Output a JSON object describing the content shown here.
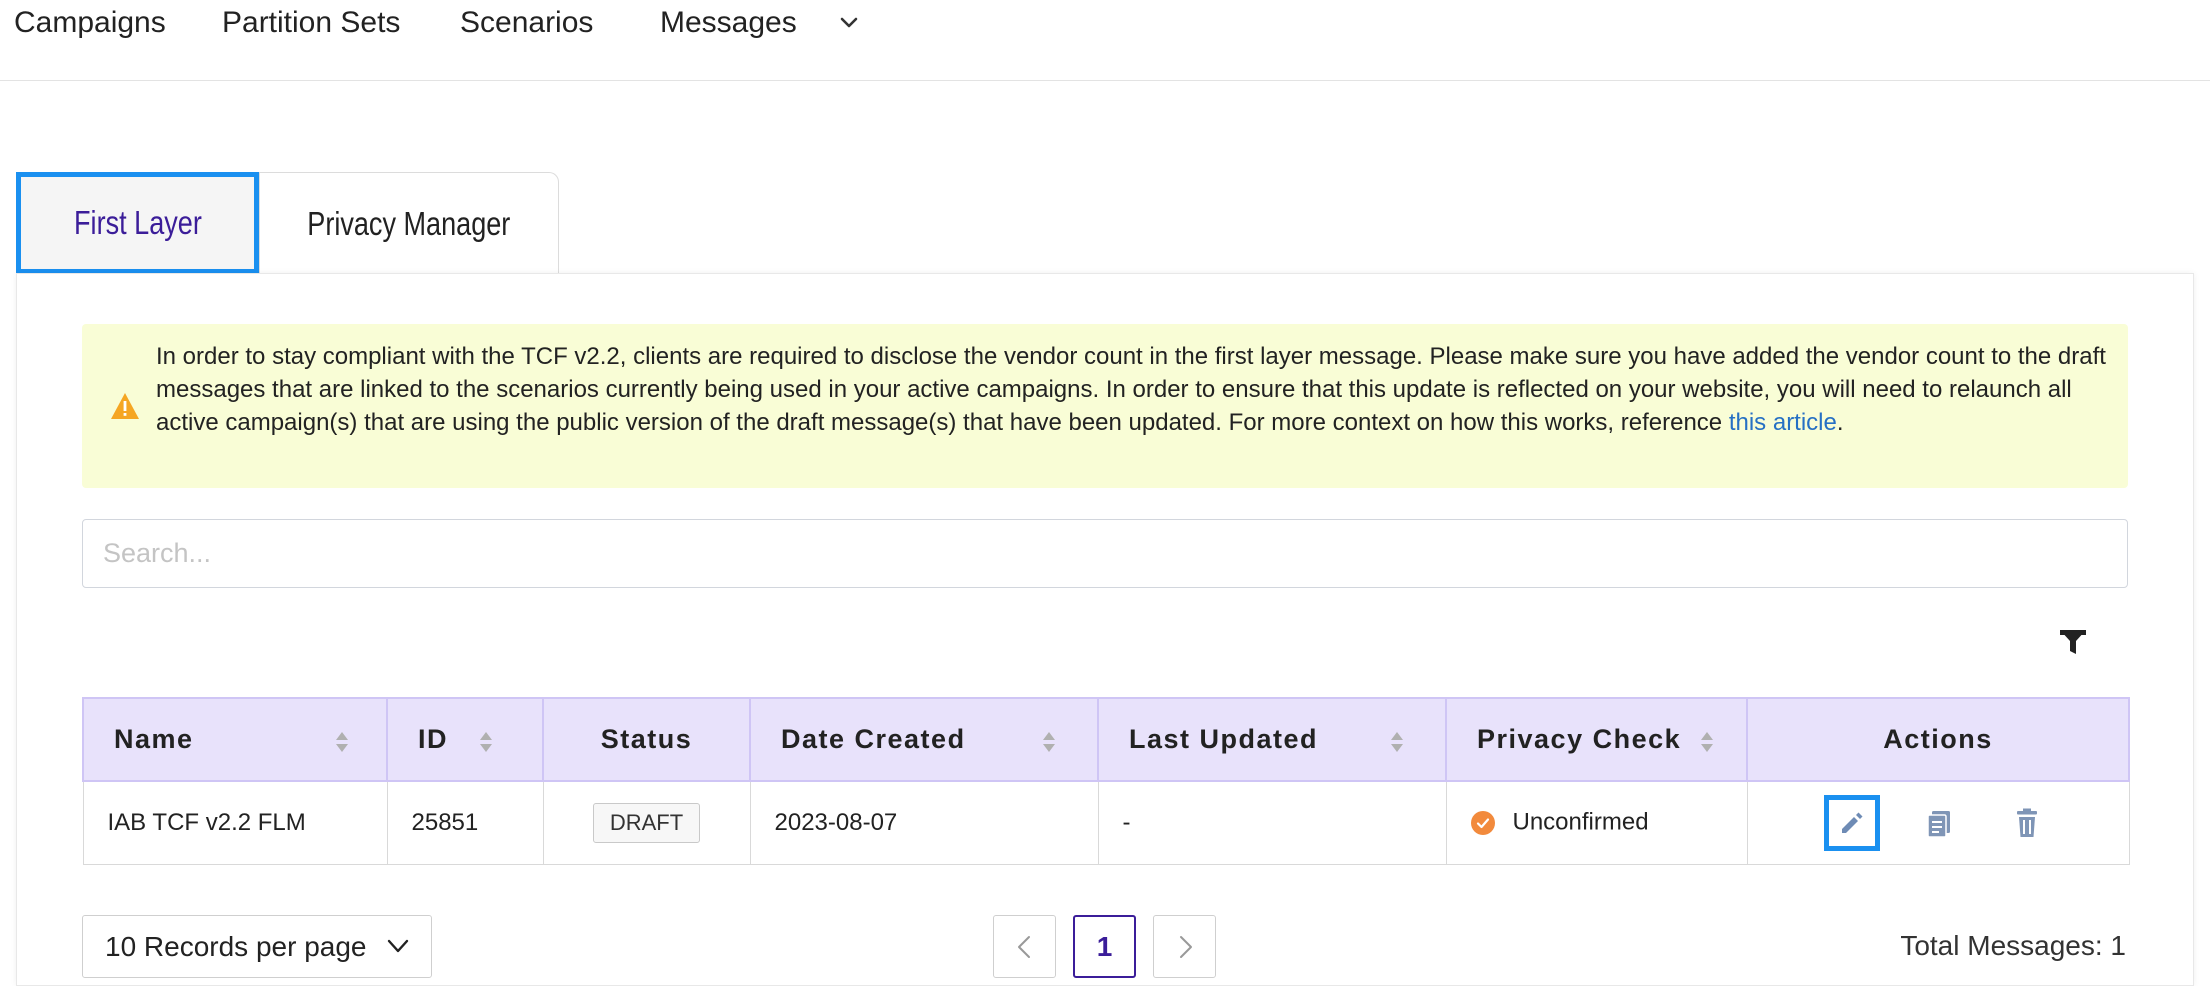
{
  "nav": {
    "items": [
      "Campaigns",
      "Partition Sets",
      "Scenarios",
      "Messages"
    ]
  },
  "tabs": {
    "first": "First Layer",
    "privacy": "Privacy Manager"
  },
  "alert": {
    "text": "In order to stay compliant with the TCF v2.2, clients are required to disclose the vendor count in the first layer message. Please make sure you have added the vendor count to the draft messages that are linked to the scenarios currently being used in your active campaigns. In order to ensure that this update is reflected on your website, you will need to relaunch all active campaign(s) that are using the public version of the draft message(s) that have been updated. For more context on how this works, reference ",
    "link": "this article",
    "after": "."
  },
  "search": {
    "placeholder": "Search..."
  },
  "table": {
    "headers": [
      "Name",
      "ID",
      "Status",
      "Date Created",
      "Last Updated",
      "Privacy Check",
      "Actions"
    ],
    "rows": [
      {
        "name": "IAB TCF v2.2 FLM",
        "id": "25851",
        "status": "DRAFT",
        "date_created": "2023-08-07",
        "last_updated": "-",
        "privacy_check": "Unconfirmed"
      }
    ]
  },
  "footer": {
    "records_per_page": "10 Records per page",
    "current_page": "1",
    "total": "Total Messages: 1"
  },
  "colors": {
    "accent": "#1a90f0",
    "primary": "#3b1d99",
    "header_bg": "#e8e2fb",
    "alert_bg": "#f9fdd6",
    "warning": "#f5a623",
    "unconfirmed": "#f28a3c"
  }
}
